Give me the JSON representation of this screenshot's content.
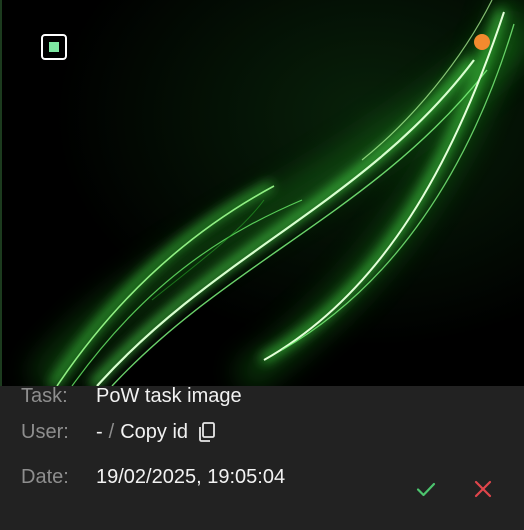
{
  "colors": {
    "accent_green": "#7ee8a2",
    "status_dot": "#f28a2e",
    "approve": "#4cc46e",
    "reject": "#e0454b"
  },
  "card": {
    "selected": true,
    "status_icon": "status-dot-pending"
  },
  "fields": {
    "task_label": "Task:",
    "task_value": "PoW task image",
    "user_label": "User:",
    "user_value": "-",
    "user_separator": "/",
    "copy_label": "Copy id",
    "copy_icon": "copy-icon",
    "date_label": "Date:",
    "date_value": "19/02/2025, 19:05:04"
  },
  "actions": {
    "approve_icon": "check-icon",
    "reject_icon": "close-icon"
  }
}
